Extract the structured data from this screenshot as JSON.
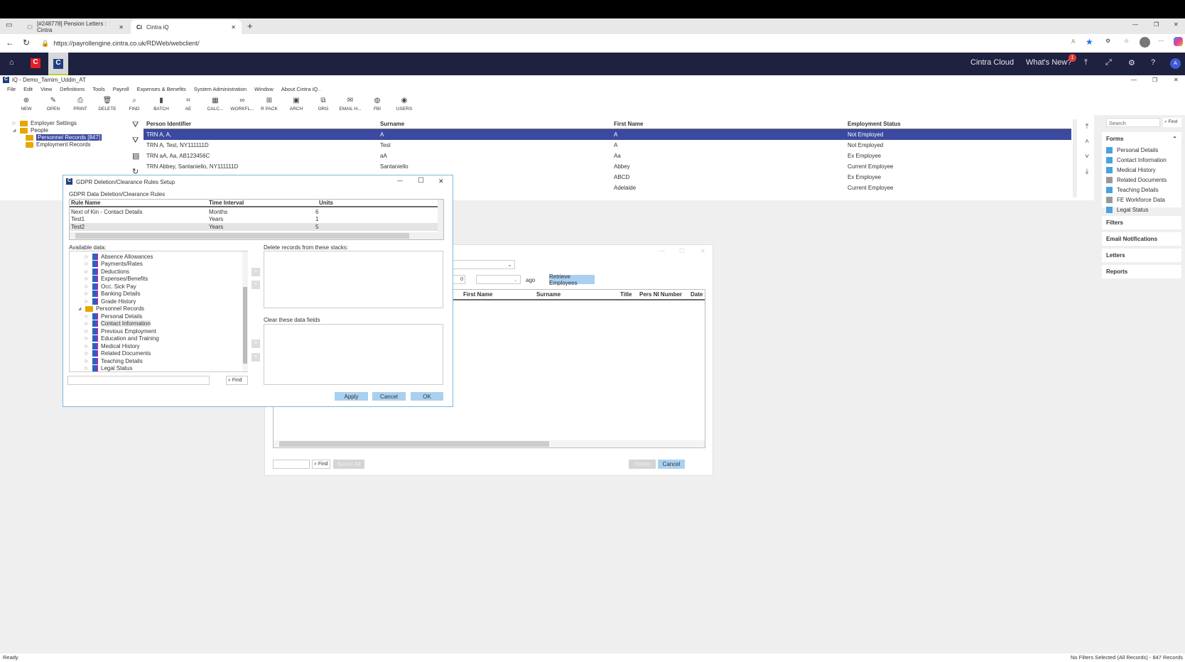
{
  "browser": {
    "tabs": [
      {
        "label": "[#248778] Pension Letters : Cintra",
        "active": false
      },
      {
        "label": "Cintra iQ",
        "active": true
      }
    ],
    "url": "https://payrollengine.cintra.co.uk/RDWeb/webclient/"
  },
  "appnav": {
    "cintra_cloud": "Cintra Cloud",
    "whats_new": "What's New?",
    "badge": "1",
    "avatar": "A"
  },
  "window": {
    "title": "iQ - Demo_Tamim_Uddin_AT"
  },
  "menu": [
    "File",
    "Edit",
    "View",
    "Definitions",
    "Tools",
    "Payroll",
    "Expenses & Benefits",
    "System Administration",
    "Window",
    "About Cintra iQ.."
  ],
  "toolbar": [
    {
      "icon": "⊕",
      "label": "NEW"
    },
    {
      "icon": "✎",
      "label": "OPEN"
    },
    {
      "icon": "⎙",
      "label": "PRINT"
    },
    {
      "icon": "🗑",
      "label": "DELETE"
    },
    {
      "icon": "⌕",
      "label": "FIND"
    },
    {
      "icon": "▮",
      "label": "BATCH"
    },
    {
      "icon": "⌗",
      "label": "AE"
    },
    {
      "icon": "▦",
      "label": "CALC..."
    },
    {
      "icon": "∞",
      "label": "WORKFL..."
    },
    {
      "icon": "⊞",
      "label": "R PACK"
    },
    {
      "icon": "▣",
      "label": "ARCH"
    },
    {
      "icon": "⧉",
      "label": "ORG"
    },
    {
      "icon": "✉",
      "label": "EMAIL H..."
    },
    {
      "icon": "◍",
      "label": "FBI"
    },
    {
      "icon": "◉",
      "label": "USERS"
    }
  ],
  "tree": {
    "employer_settings": "Employer Settings",
    "people": "People",
    "personnel_records": "Personnel Records [847]",
    "employment_records": "Employment Records"
  },
  "grid": {
    "headers": [
      "Person Identifier",
      "Surname",
      "First Name",
      "Employment Status"
    ],
    "rows": [
      [
        "TRN A, A,",
        "A",
        "A",
        "Not Employed"
      ],
      [
        "TRN A, Test, NY111111D",
        "Test",
        "A",
        "Not Employed"
      ],
      [
        "TRN aA, Aa, AB123456C",
        "aA",
        "Aa",
        "Ex Employee"
      ],
      [
        "TRN Abbey, Santaniello, NY111111D",
        "Santaniello",
        "Abbey",
        "Current Employee"
      ],
      [
        "",
        "",
        "ABCD",
        "Ex Employee"
      ],
      [
        "",
        "",
        "Adelaide",
        "Current Employee"
      ]
    ]
  },
  "right_panel": {
    "search_placeholder": "Search",
    "find": "Find",
    "forms_title": "Forms",
    "forms": [
      "Personal Details",
      "Contact Information",
      "Medical History",
      "Related Documents",
      "Teaching Details",
      "FE Workforce Data",
      "Legal Status"
    ],
    "sections": [
      "Filters",
      "Email Notifications",
      "Letters",
      "Reports"
    ]
  },
  "bg_dialog": {
    "number_value": "0",
    "ago": "ago",
    "retrieve": "Retrieve Employees",
    "headers": [
      "First Name",
      "Surname",
      "Title",
      "Pers NI Number",
      "Date"
    ],
    "find": "Find",
    "select_all": "Select All",
    "delete": "Delete",
    "cancel": "Cancel"
  },
  "gdpr": {
    "title": "GDPR Deletion/Clearance Rules Setup",
    "subtitle": "GDPR Data Deletion/Clearance Rules",
    "headers": [
      "Rule Name",
      "Time Interval",
      "Units"
    ],
    "rules": [
      [
        "Next of Kin - Contact Details",
        "Months",
        "6"
      ],
      [
        "Test1",
        "Years",
        "1"
      ],
      [
        "Test2",
        "Years",
        "5"
      ]
    ],
    "available_label": "Available data:",
    "available_items": [
      {
        "label": "Absence Allowances",
        "level": 1
      },
      {
        "label": "Payments/Rates",
        "level": 1
      },
      {
        "label": "Deductions",
        "level": 1
      },
      {
        "label": "Expenses/Benefits",
        "level": 1
      },
      {
        "label": "Occ. Sick Pay",
        "level": 1
      },
      {
        "label": "Banking Details",
        "level": 1
      },
      {
        "label": "Grade History",
        "level": 1
      },
      {
        "label": "Personnel Records",
        "level": 0
      },
      {
        "label": "Personal Details",
        "level": 1
      },
      {
        "label": "Contact Information",
        "level": 1
      },
      {
        "label": "Previous Employment",
        "level": 1
      },
      {
        "label": "Education and Training",
        "level": 1
      },
      {
        "label": "Medical History",
        "level": 1
      },
      {
        "label": "Related Documents",
        "level": 1
      },
      {
        "label": "Teaching Details",
        "level": 1
      },
      {
        "label": "Legal Status",
        "level": 1
      }
    ],
    "delete_label": "Delete records from these stacks:",
    "clear_label": "Clear these data fields",
    "find": "Find",
    "apply": "Apply",
    "cancel": "Cancel",
    "ok": "OK"
  },
  "status": {
    "left": "Ready",
    "right": "No Filters Selected (All Records) - 847 Records"
  }
}
